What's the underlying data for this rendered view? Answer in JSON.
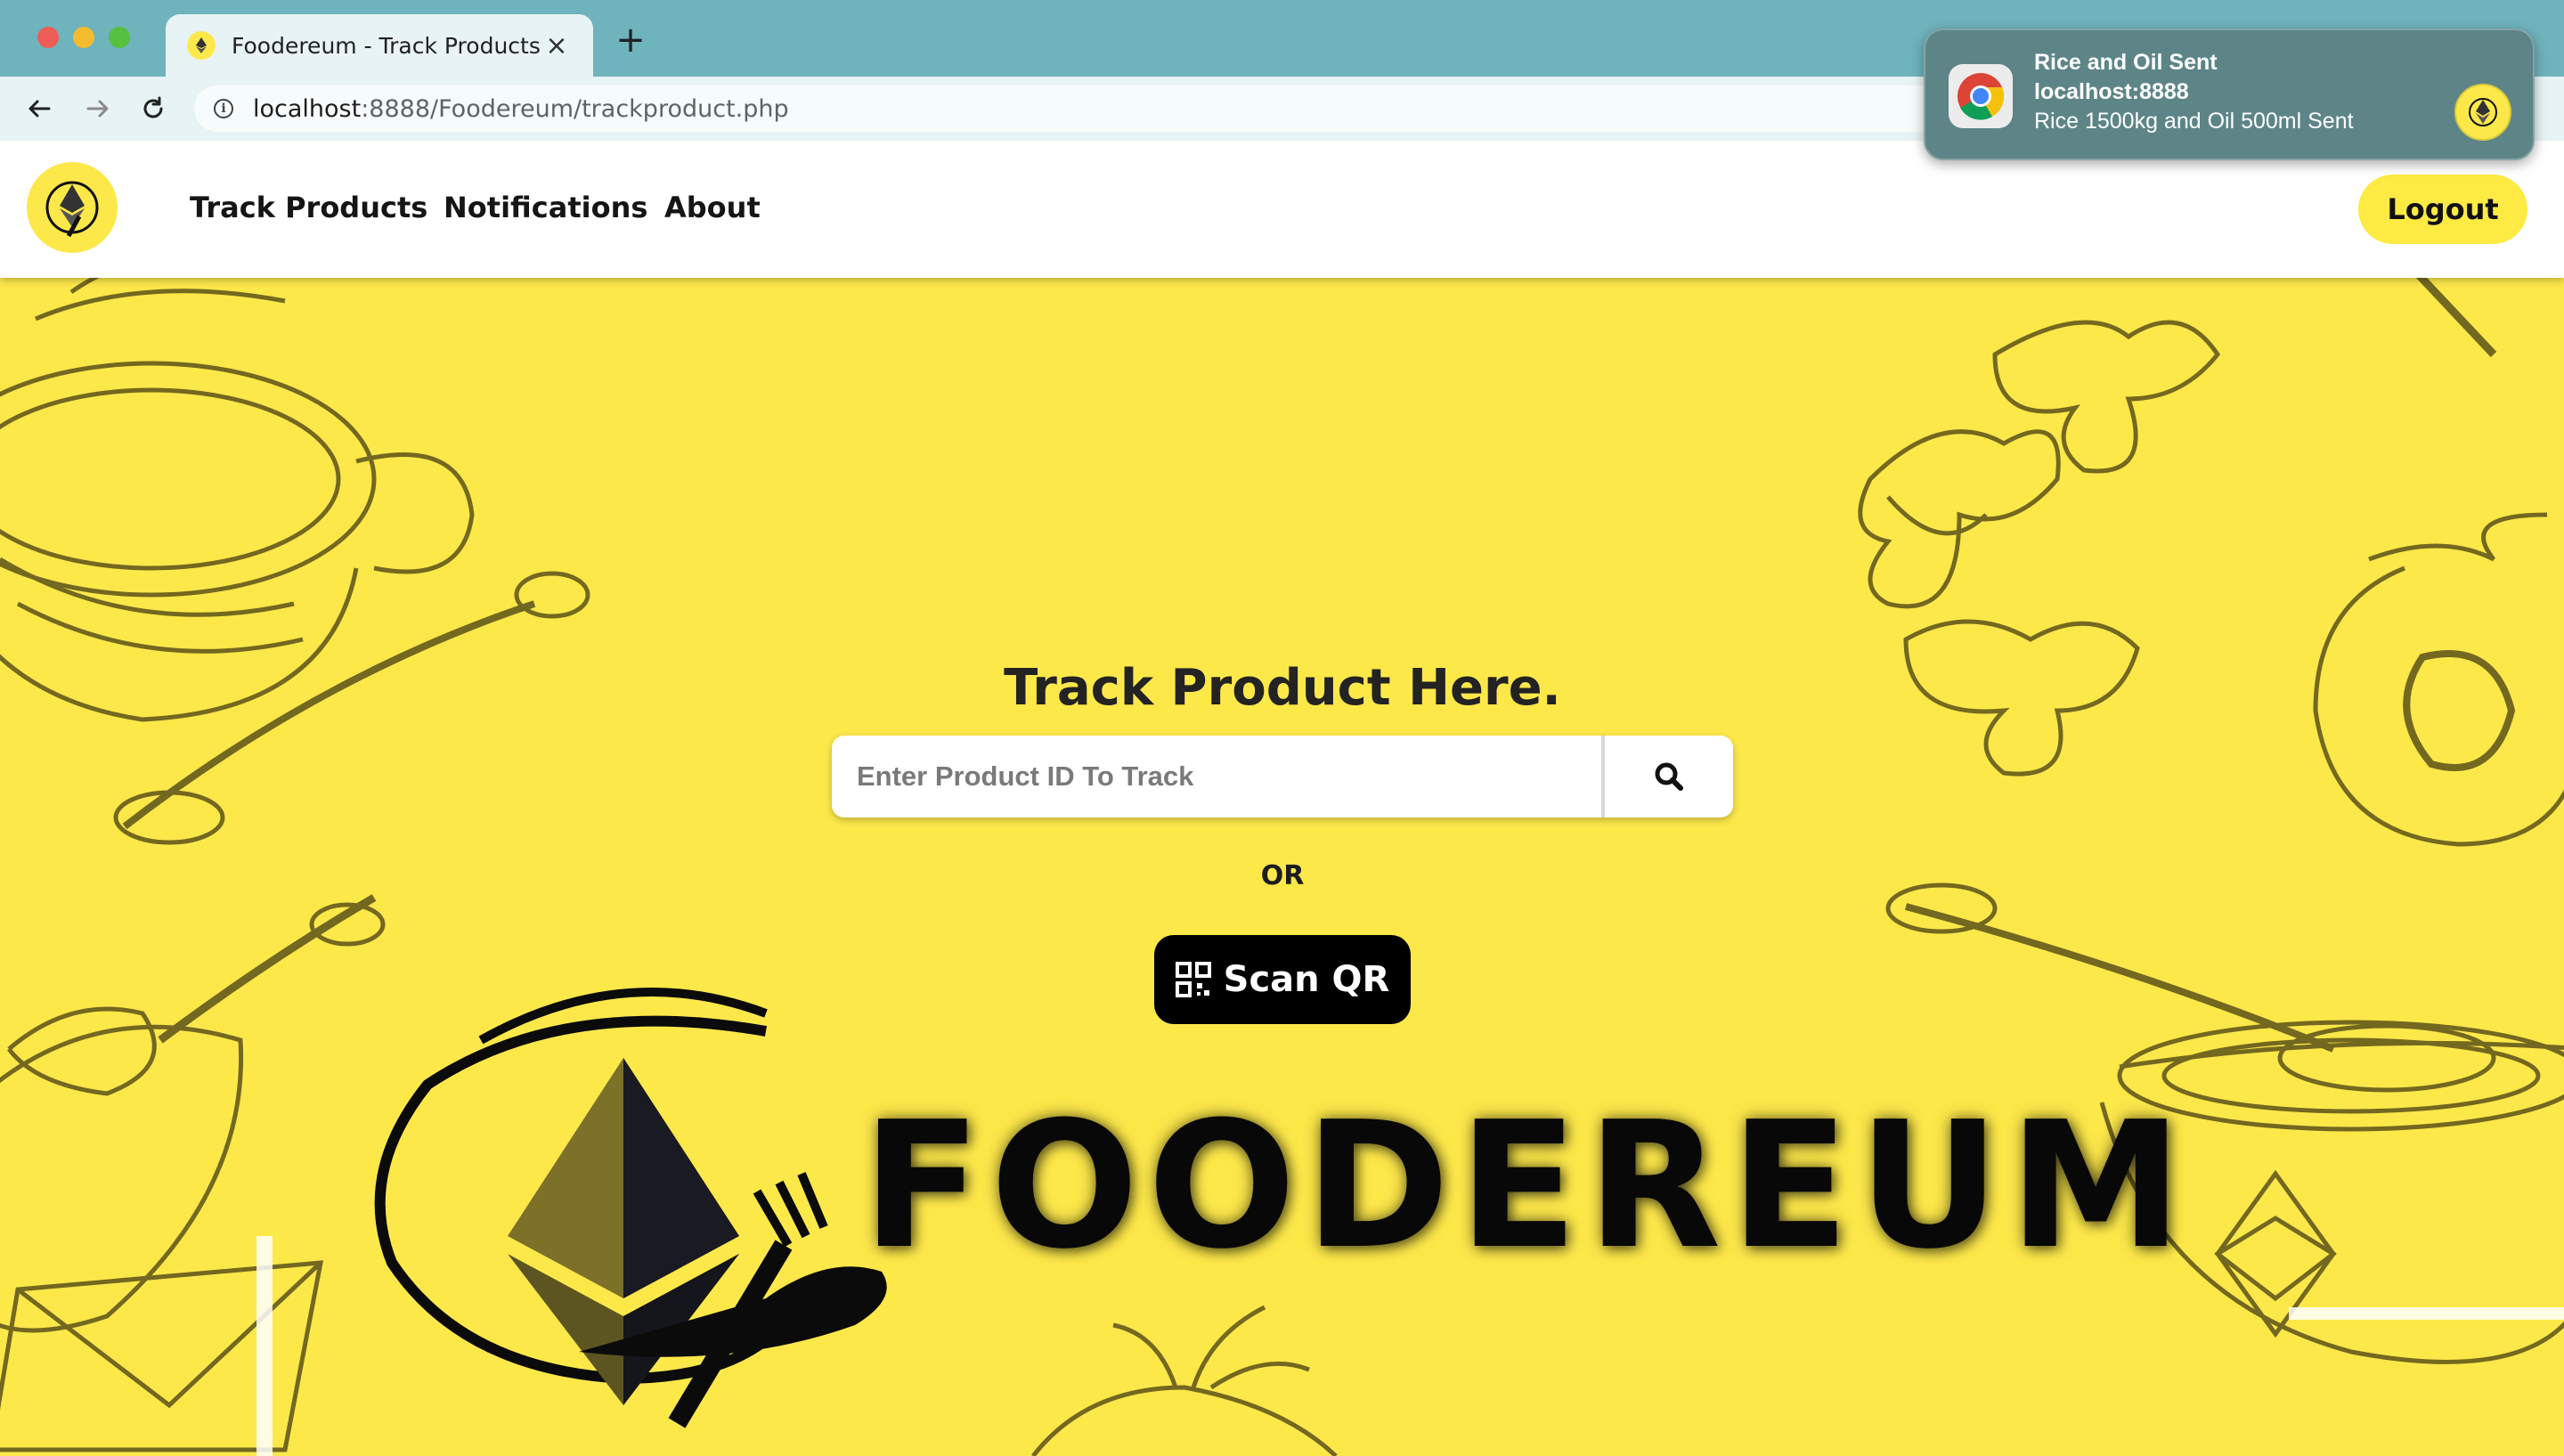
{
  "browser": {
    "tab": {
      "title": "Foodereum - Track Products",
      "close_glyph": "×"
    },
    "new_tab_glyph": "+",
    "address": {
      "host": "localhost",
      "path": ":8888/Foodereum/trackproduct.php"
    }
  },
  "notification": {
    "title": "Rice and Oil Sent",
    "source": "localhost:8888",
    "body": "Rice 1500kg and Oil 500ml Sent",
    "app_icon": "chrome-icon"
  },
  "site": {
    "nav": {
      "items": [
        {
          "label": "Track Products"
        },
        {
          "label": "Notifications"
        },
        {
          "label": "About"
        }
      ],
      "logout_label": "Logout"
    },
    "main": {
      "heading": "Track Product Here.",
      "search": {
        "placeholder": "Enter Product ID To Track",
        "button_icon": "search-icon"
      },
      "or_text": "OR",
      "scan_label": "Scan QR",
      "brand_word": "FOODEREUM"
    }
  },
  "colors": {
    "page_background": "#fde84a",
    "logout_button": "#fdea42",
    "scan_button": "#000000",
    "tab_strip": "#6fb3bd",
    "notification": "#5d8587"
  }
}
